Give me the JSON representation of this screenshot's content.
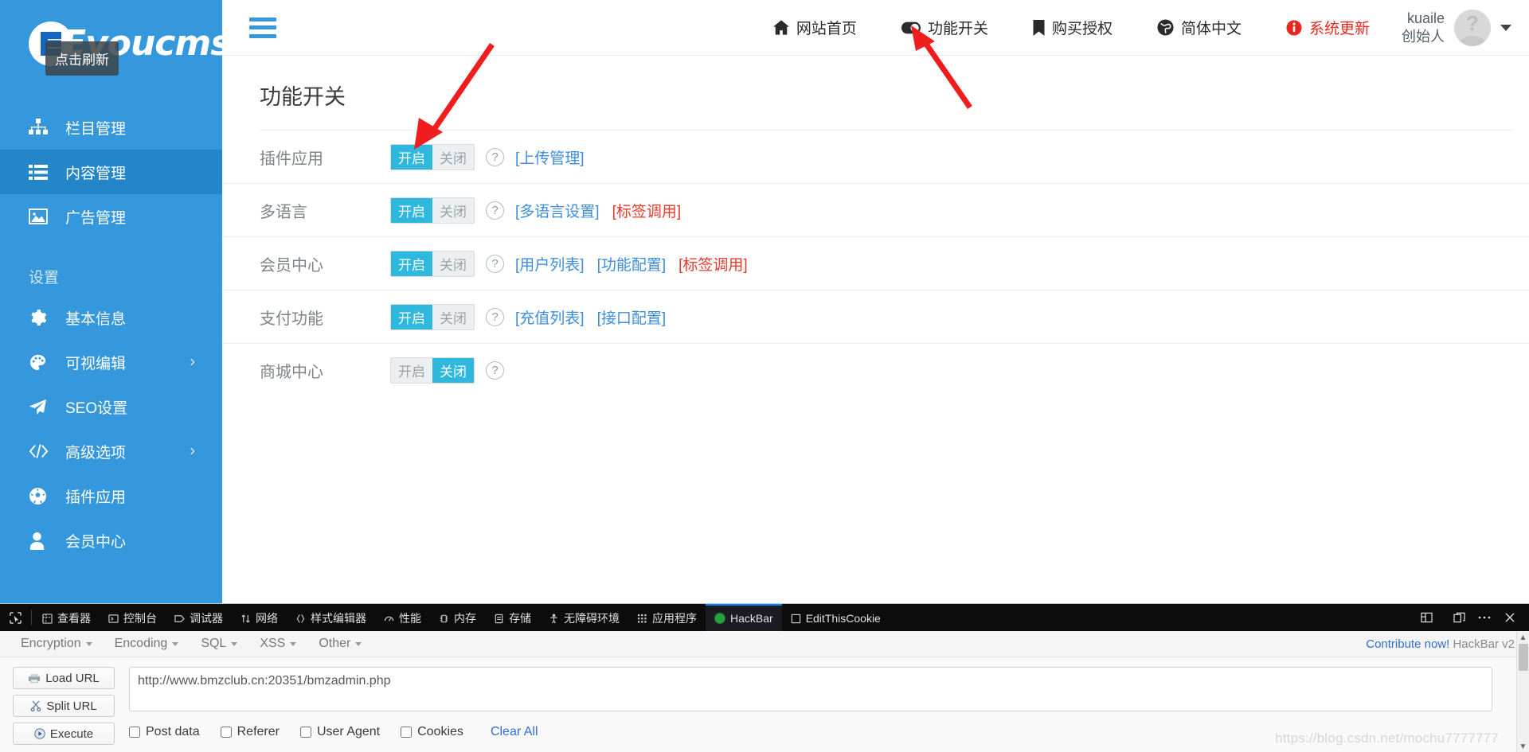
{
  "sidebar": {
    "logo": {
      "text": "Eyoucms",
      "tooltip": "点击刷新"
    },
    "items": [
      {
        "label": "栏目管理",
        "icon": "sitemap-icon",
        "active": false,
        "arrow": false
      },
      {
        "label": "内容管理",
        "icon": "list-icon",
        "active": true,
        "arrow": false
      },
      {
        "label": "广告管理",
        "icon": "image-icon",
        "active": false,
        "arrow": false
      }
    ],
    "section_title": "设置",
    "settings_items": [
      {
        "label": "基本信息",
        "icon": "gear-icon",
        "arrow": false
      },
      {
        "label": "可视编辑",
        "icon": "palette-icon",
        "arrow": true
      },
      {
        "label": "SEO设置",
        "icon": "paper-plane-icon",
        "arrow": false
      },
      {
        "label": "高级选项",
        "icon": "code-icon",
        "arrow": true
      },
      {
        "label": "插件应用",
        "icon": "soccer-icon",
        "arrow": false
      },
      {
        "label": "会员中心",
        "icon": "user-icon",
        "arrow": false
      }
    ]
  },
  "topbar": {
    "nav": [
      {
        "label": "网站首页",
        "icon": "home-icon"
      },
      {
        "label": "功能开关",
        "icon": "toggle-icon"
      },
      {
        "label": "购买授权",
        "icon": "bookmark-icon"
      },
      {
        "label": "简体中文",
        "icon": "globe-icon"
      },
      {
        "label": "系统更新",
        "icon": "info-circle-icon",
        "alert": true
      }
    ],
    "user": {
      "name": "kuaile",
      "role": "创始人"
    }
  },
  "content": {
    "page_title": "功能开关",
    "switch_on_label": "开启",
    "switch_off_label": "关闭",
    "rows": [
      {
        "label": "插件应用",
        "state": "on",
        "links": [
          {
            "text": "[上传管理]",
            "style": "blue"
          }
        ]
      },
      {
        "label": "多语言",
        "state": "on",
        "links": [
          {
            "text": "[多语言设置]",
            "style": "blue"
          },
          {
            "text": "[标签调用]",
            "style": "red"
          }
        ]
      },
      {
        "label": "会员中心",
        "state": "on",
        "links": [
          {
            "text": "[用户列表]",
            "style": "blue"
          },
          {
            "text": "[功能配置]",
            "style": "blue"
          },
          {
            "text": "[标签调用]",
            "style": "red"
          }
        ]
      },
      {
        "label": "支付功能",
        "state": "on",
        "links": [
          {
            "text": "[充值列表]",
            "style": "blue"
          },
          {
            "text": "[接口配置]",
            "style": "blue"
          }
        ]
      },
      {
        "label": "商城中心",
        "state": "off",
        "links": []
      }
    ]
  },
  "devtools": {
    "tabs": [
      {
        "label": "查看器",
        "icon": "inspector-icon",
        "active": false
      },
      {
        "label": "控制台",
        "icon": "console-icon",
        "active": false
      },
      {
        "label": "调试器",
        "icon": "debugger-icon",
        "active": false
      },
      {
        "label": "网络",
        "icon": "network-icon",
        "active": false
      },
      {
        "label": "样式编辑器",
        "icon": "style-editor-icon",
        "active": false
      },
      {
        "label": "性能",
        "icon": "performance-icon",
        "active": false
      },
      {
        "label": "内存",
        "icon": "memory-icon",
        "active": false
      },
      {
        "label": "存储",
        "icon": "storage-icon",
        "active": false
      },
      {
        "label": "无障碍环境",
        "icon": "accessibility-icon",
        "active": false
      },
      {
        "label": "应用程序",
        "icon": "application-icon",
        "active": false
      },
      {
        "label": "HackBar",
        "icon": "hackbar-icon",
        "active": true
      },
      {
        "label": "EditThisCookie",
        "icon": "cookie-icon",
        "active": false
      }
    ]
  },
  "hackbar": {
    "menus": [
      {
        "label": "Encryption"
      },
      {
        "label": "Encoding"
      },
      {
        "label": "SQL"
      },
      {
        "label": "XSS"
      },
      {
        "label": "Other"
      }
    ],
    "contribute_link": "Contribute now!",
    "version": "HackBar v2",
    "buttons": [
      {
        "label": "Load URL",
        "icon": "load-url-icon"
      },
      {
        "label": "Split URL",
        "icon": "scissors-icon"
      },
      {
        "label": "Execute",
        "icon": "play-icon"
      }
    ],
    "url_value": "http://www.bmzclub.cn:20351/bmzadmin.php",
    "checkboxes": [
      {
        "label": "Post data",
        "checked": false
      },
      {
        "label": "Referer",
        "checked": false
      },
      {
        "label": "User Agent",
        "checked": false
      },
      {
        "label": "Cookies",
        "checked": false
      }
    ],
    "clear_all_label": "Clear All"
  },
  "watermark": "https://blog.csdn.net/mochu7777777"
}
